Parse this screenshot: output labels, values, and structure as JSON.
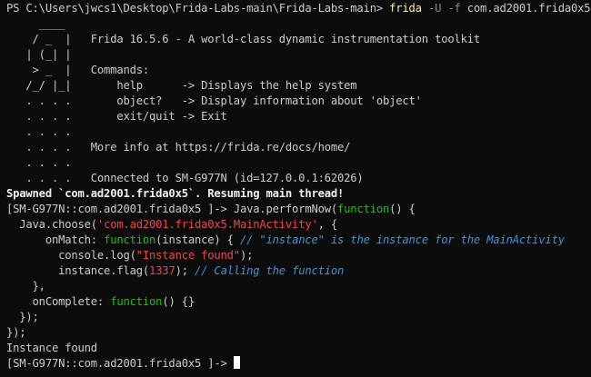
{
  "prompt": {
    "path": "PS C:\\Users\\jwcs1\\Desktop\\Frida-Labs-main\\Frida-Labs-main> ",
    "command": "frida",
    "flags": " -U -f ",
    "package": "com.ad2001.frida0x5"
  },
  "banner": [
    {
      "art": "     ____",
      "text": ""
    },
    {
      "art": "    / _  |",
      "text": "   Frida 16.5.6 - A world-class dynamic instrumentation toolkit"
    },
    {
      "art": "   | (_| |",
      "text": ""
    },
    {
      "art": "    > _  |",
      "text": "   Commands:"
    },
    {
      "art": "   /_/ |_|",
      "text": "       help      -> Displays the help system"
    },
    {
      "art": "   . . . .",
      "text": "       object?   -> Display information about 'object'"
    },
    {
      "art": "   . . . .",
      "text": "       exit/quit -> Exit"
    },
    {
      "art": "   . . . .",
      "text": ""
    },
    {
      "art": "   . . . .",
      "text": "   More info at https://frida.re/docs/home/"
    },
    {
      "art": "   . . . .",
      "text": ""
    },
    {
      "art": "   . . . .",
      "text": "   Connected to SM-G977N (id=127.0.0.1:62026)"
    }
  ],
  "spawned": "Spawned `com.ad2001.frida0x5`. Resuming main thread!",
  "repl_prompt": "[SM-G977N::com.ad2001.frida0x5 ]-> ",
  "code": {
    "l1_a": "Java.performNow(",
    "l1_kw": "function",
    "l1_b": "() {",
    "l2_a": "  Java.choose(",
    "l2_str": "'com.ad2001.frida0x5.MainActivity'",
    "l2_b": ", {",
    "l3_a": "      onMatch: ",
    "l3_kw": "function",
    "l3_b": "(instance) { ",
    "l3_comment": "// \"instance\" is the instance for the MainActivity",
    "l4_a": "        console.log(",
    "l4_str": "\"Instance found\"",
    "l4_b": ");",
    "l5_a": "        instance.flag(",
    "l5_num": "1337",
    "l5_b": "); ",
    "l5_comment": "// Calling the function",
    "l6": "    },",
    "l7_a": "    onComplete: ",
    "l7_kw": "function",
    "l7_b": "() {}",
    "l8": "  });",
    "l9": "});"
  },
  "output": "Instance found",
  "colors": {
    "background": "#0c0c0c",
    "text": "#cccccc",
    "command": "#f9f1a5",
    "keyword": "#16c60c",
    "string": "#e74856",
    "comment": "#3a96dd"
  }
}
